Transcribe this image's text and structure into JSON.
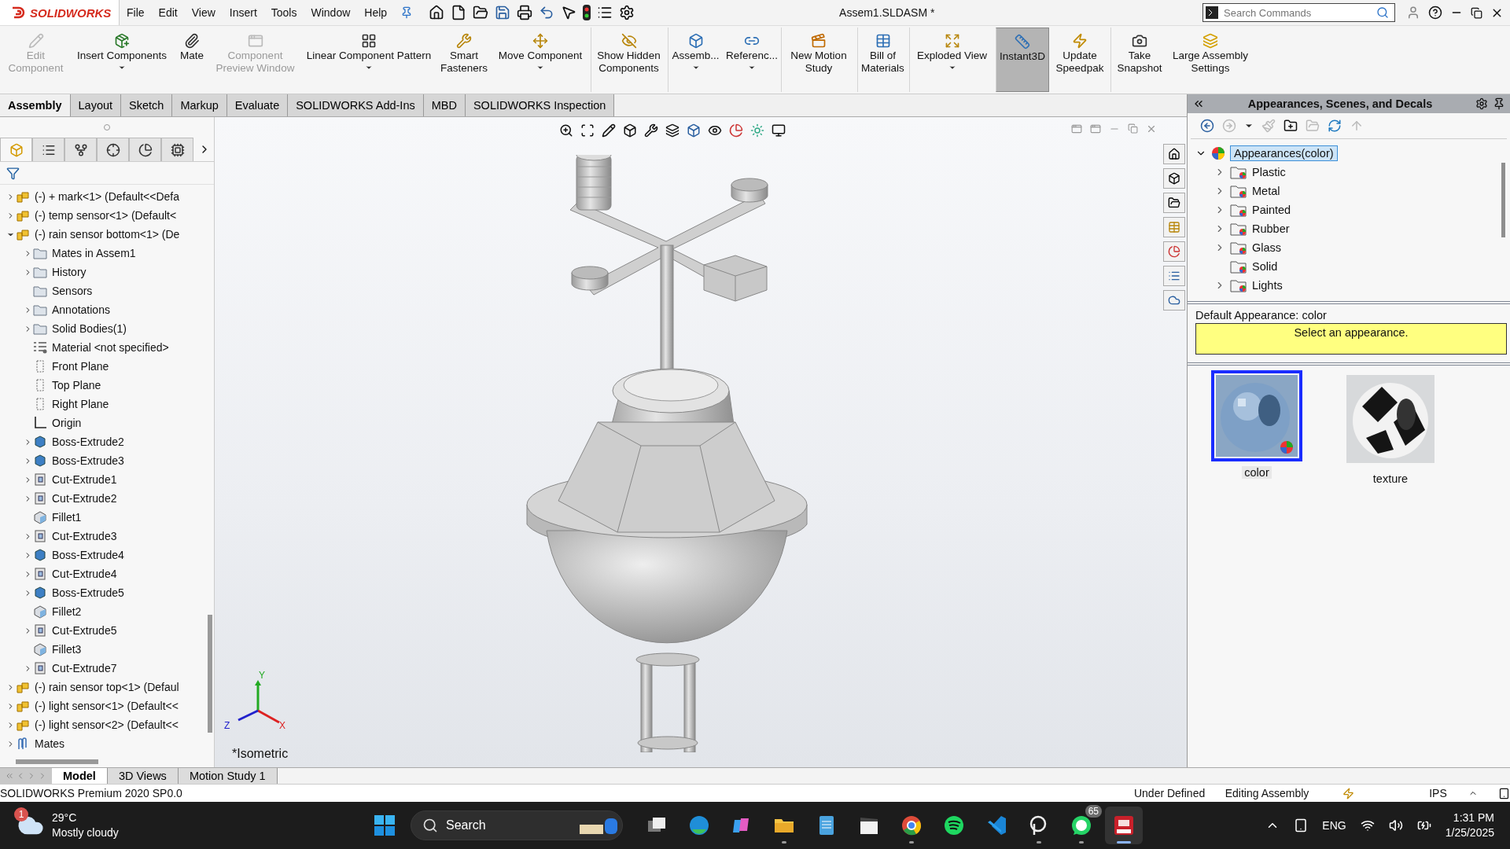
{
  "app": {
    "logo": "SOLIDWORKS",
    "menu": [
      "File",
      "Edit",
      "View",
      "Insert",
      "Tools",
      "Window",
      "Help"
    ],
    "title": "Assem1.SLDASM *",
    "search": {
      "placeholder": "Search Commands"
    }
  },
  "ribbon": [
    {
      "label": "Edit Component",
      "disabled": true,
      "dropdown": false,
      "on": false,
      "separator": false
    },
    {
      "label": "Insert Components",
      "disabled": false,
      "dropdown": true,
      "on": false,
      "separator": false
    },
    {
      "label": "Mate",
      "disabled": false,
      "dropdown": false,
      "on": false,
      "separator": false
    },
    {
      "label": "Component Preview Window",
      "disabled": true,
      "dropdown": false,
      "on": false,
      "separator": false
    },
    {
      "label": "Linear Component Pattern",
      "disabled": false,
      "dropdown": true,
      "on": false,
      "separator": false
    },
    {
      "label": "Smart Fasteners",
      "disabled": false,
      "dropdown": false,
      "on": false,
      "separator": false
    },
    {
      "label": "Move Component",
      "disabled": false,
      "dropdown": true,
      "on": false,
      "separator": false
    },
    {
      "label": "Show Hidden Components",
      "disabled": false,
      "dropdown": false,
      "on": false,
      "separator": true
    },
    {
      "label": "Assemb...",
      "disabled": false,
      "dropdown": true,
      "on": false,
      "separator": true
    },
    {
      "label": "Referenc...",
      "disabled": false,
      "dropdown": true,
      "on": false,
      "separator": false
    },
    {
      "label": "New Motion Study",
      "disabled": false,
      "dropdown": false,
      "on": false,
      "separator": true
    },
    {
      "label": "Bill of Materials",
      "disabled": false,
      "dropdown": false,
      "on": false,
      "separator": true
    },
    {
      "label": "Exploded View",
      "disabled": false,
      "dropdown": true,
      "on": false,
      "separator": true
    },
    {
      "label": "Instant3D",
      "disabled": false,
      "dropdown": false,
      "on": true,
      "separator": true
    },
    {
      "label": "Update Speedpak",
      "disabled": false,
      "dropdown": false,
      "on": false,
      "separator": false
    },
    {
      "label": "Take Snapshot",
      "disabled": false,
      "dropdown": false,
      "on": false,
      "separator": true
    },
    {
      "label": "Large Assembly Settings",
      "disabled": false,
      "dropdown": false,
      "on": false,
      "separator": false
    }
  ],
  "command_tabs": [
    {
      "label": "Assembly",
      "selected": true
    },
    {
      "label": "Layout",
      "selected": false
    },
    {
      "label": "Sketch",
      "selected": false
    },
    {
      "label": "Markup",
      "selected": false
    },
    {
      "label": "Evaluate",
      "selected": false
    },
    {
      "label": "SOLIDWORKS Add-Ins",
      "selected": false
    },
    {
      "label": "MBD",
      "selected": false
    },
    {
      "label": "SOLIDWORKS Inspection",
      "selected": false
    }
  ],
  "feature_tree": {
    "panel_tabs": [
      {
        "kind": "feature",
        "selected": true
      },
      {
        "kind": "property",
        "selected": false
      },
      {
        "kind": "config",
        "selected": false
      },
      {
        "kind": "dimxpert",
        "selected": false
      },
      {
        "kind": "display",
        "selected": false
      },
      {
        "kind": "cam",
        "selected": false
      }
    ],
    "items": [
      {
        "label": "(-) + mark<1> (Default<<Defa",
        "kind": "component",
        "expandable": true
      },
      {
        "label": "(-) temp sensor<1> (Default<",
        "kind": "component",
        "expandable": true
      },
      {
        "label": "(-) rain sensor bottom<1> (De",
        "kind": "component",
        "expandable": true,
        "expanded": true,
        "children": [
          {
            "label": "Mates in Assem1",
            "kind": "folder",
            "expandable": true
          },
          {
            "label": "History",
            "kind": "folder",
            "expandable": true
          },
          {
            "label": "Sensors",
            "kind": "folder",
            "expandable": false
          },
          {
            "label": "Annotations",
            "kind": "folder",
            "expandable": true
          },
          {
            "label": "Solid Bodies(1)",
            "kind": "folder",
            "expandable": true
          },
          {
            "label": "Material <not specified>",
            "kind": "material",
            "expandable": false
          },
          {
            "label": "Front Plane",
            "kind": "plane",
            "expandable": false
          },
          {
            "label": "Top Plane",
            "kind": "plane",
            "expandable": false
          },
          {
            "label": "Right Plane",
            "kind": "plane",
            "expandable": false
          },
          {
            "label": "Origin",
            "kind": "origin",
            "expandable": false
          },
          {
            "label": "Boss-Extrude2",
            "kind": "boss",
            "expandable": true
          },
          {
            "label": "Boss-Extrude3",
            "kind": "boss",
            "expandable": true
          },
          {
            "label": "Cut-Extrude1",
            "kind": "cut",
            "expandable": true
          },
          {
            "label": "Cut-Extrude2",
            "kind": "cut",
            "expandable": true
          },
          {
            "label": "Fillet1",
            "kind": "fillet",
            "expandable": false
          },
          {
            "label": "Cut-Extrude3",
            "kind": "cut",
            "expandable": true
          },
          {
            "label": "Boss-Extrude4",
            "kind": "boss",
            "expandable": true
          },
          {
            "label": "Cut-Extrude4",
            "kind": "cut",
            "expandable": true
          },
          {
            "label": "Boss-Extrude5",
            "kind": "boss",
            "expandable": true
          },
          {
            "label": "Fillet2",
            "kind": "fillet",
            "expandable": false
          },
          {
            "label": "Cut-Extrude5",
            "kind": "cut",
            "expandable": true
          },
          {
            "label": "Fillet3",
            "kind": "fillet",
            "expandable": false
          },
          {
            "label": "Cut-Extrude7",
            "kind": "cut",
            "expandable": true
          }
        ]
      },
      {
        "label": "(-) rain sensor top<1> (Defaul",
        "kind": "component",
        "expandable": true
      },
      {
        "label": "(-) light sensor<1> (Default<<",
        "kind": "component",
        "expandable": true
      },
      {
        "label": "(-) light sensor<2> (Default<<",
        "kind": "component",
        "expandable": true
      },
      {
        "label": "Mates",
        "kind": "mates",
        "expandable": true
      }
    ]
  },
  "viewport": {
    "view_name": "*Isometric",
    "triad": {
      "x": "X",
      "y": "Y",
      "z": "Z"
    }
  },
  "task_pane": {
    "title": "Appearances, Scenes, and Decals",
    "root": {
      "label": "Appearances(color)",
      "expanded": true,
      "selected": true,
      "children": [
        {
          "label": "Plastic",
          "expandable": true
        },
        {
          "label": "Metal",
          "expandable": true
        },
        {
          "label": "Painted",
          "expandable": true
        },
        {
          "label": "Rubber",
          "expandable": true
        },
        {
          "label": "Glass",
          "expandable": true
        },
        {
          "label": "Solid",
          "expandable": false
        },
        {
          "label": "Lights",
          "expandable": true
        }
      ]
    },
    "default_label": "Default Appearance: color",
    "message": "Select an appearance.",
    "swatches": [
      {
        "label": "color",
        "kind": "color",
        "selected": true
      },
      {
        "label": "texture",
        "kind": "texture",
        "selected": false
      }
    ]
  },
  "bottom_tabs": [
    {
      "label": "Model",
      "selected": true
    },
    {
      "label": "3D Views",
      "selected": false
    },
    {
      "label": "Motion Study 1",
      "selected": false
    }
  ],
  "status_bar": {
    "product": "SOLIDWORKS Premium 2020 SP0.0",
    "state": "Under Defined",
    "mode": "Editing Assembly",
    "units": "IPS"
  },
  "taskbar": {
    "weather": {
      "badge": "1",
      "temperature": "29°C",
      "condition": "Mostly cloudy"
    },
    "search": "Search",
    "apps": [
      {
        "kind": "taskview",
        "running": false,
        "active": false
      },
      {
        "kind": "edge",
        "running": false,
        "active": false
      },
      {
        "kind": "copilot",
        "running": false,
        "active": false
      },
      {
        "kind": "explorer",
        "running": true,
        "active": false
      },
      {
        "kind": "notepad",
        "running": false,
        "active": false
      },
      {
        "kind": "media",
        "running": false,
        "active": false
      },
      {
        "kind": "chrome",
        "running": true,
        "active": false
      },
      {
        "kind": "spotify",
        "running": false,
        "active": false
      },
      {
        "kind": "vscode",
        "running": false,
        "active": false
      },
      {
        "kind": "capture",
        "running": true,
        "active": false
      },
      {
        "kind": "whatsapp",
        "running": true,
        "active": false,
        "badge": "65"
      },
      {
        "kind": "solidworks",
        "running": true,
        "active": true
      }
    ],
    "tray": {
      "language": "ENG",
      "time": "1:31 PM",
      "date": "1/25/2025"
    }
  }
}
